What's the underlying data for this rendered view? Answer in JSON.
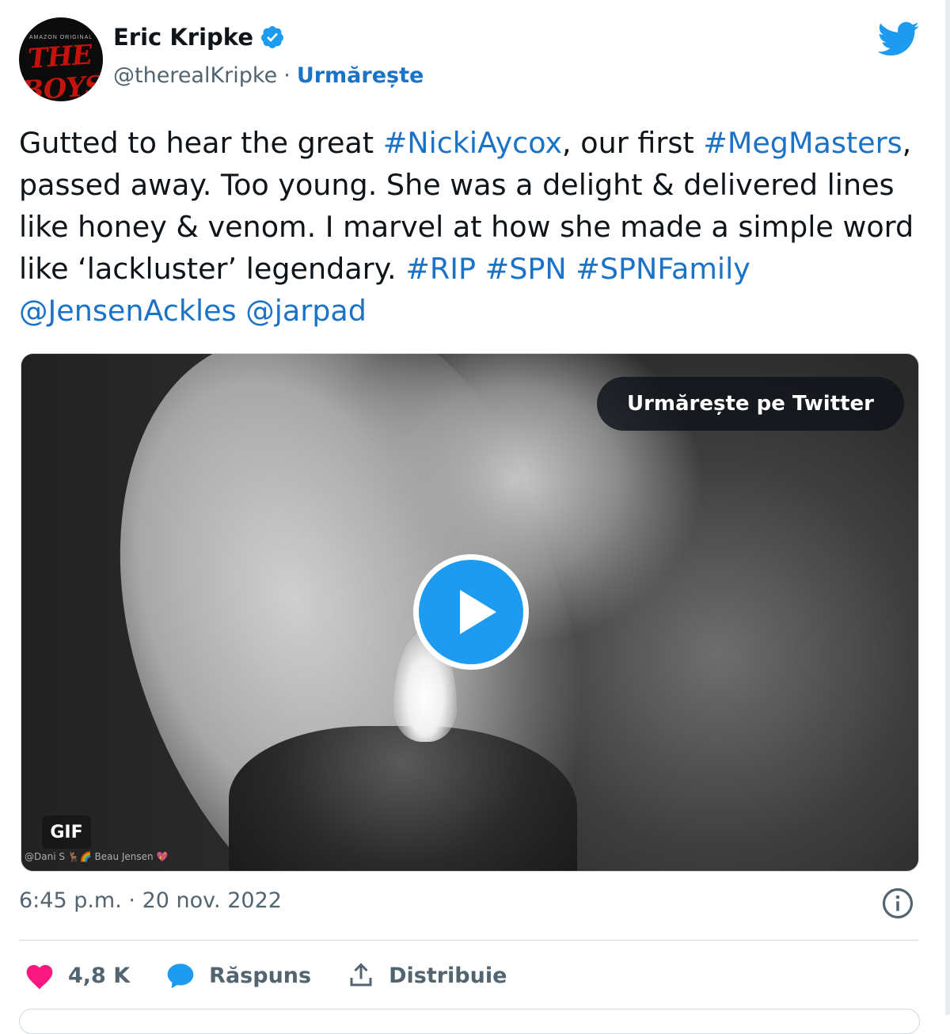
{
  "user": {
    "name": "Eric Kripke",
    "handle": "@therealKripke",
    "separator": "·",
    "follow_label": "Urmărește",
    "avatar_caption": "AMAZON ORIGINAL",
    "avatar_logo": "THE BOYS"
  },
  "tweet": {
    "segments": [
      {
        "text": "Gutted to hear the great ",
        "link": false
      },
      {
        "text": "#NickiAycox",
        "link": true
      },
      {
        "text": ", our first ",
        "link": false
      },
      {
        "text": "#MegMasters",
        "link": true
      },
      {
        "text": ", passed away. Too young. She was a delight & delivered lines like honey & venom. I marvel at how she made a simple word like ‘lackluster’ legendary. ",
        "link": false
      },
      {
        "text": "#RIP",
        "link": true
      },
      {
        "text": " ",
        "link": false
      },
      {
        "text": "#SPN",
        "link": true
      },
      {
        "text": " ",
        "link": false
      },
      {
        "text": "#SPNFamily",
        "link": true
      },
      {
        "text": " ",
        "link": false
      },
      {
        "text": "@JensenAckles",
        "link": true
      },
      {
        "text": " ",
        "link": false
      },
      {
        "text": "@jarpad",
        "link": true
      }
    ]
  },
  "media": {
    "follow_on_twitter_label": "Urmărește pe Twitter",
    "gif_badge": "GIF",
    "watermark": "@Dani S 🦌🌈 Beau Jensen 💖"
  },
  "meta": {
    "time": "6:45 p.m.",
    "separator": "·",
    "date": "20 nov. 2022"
  },
  "actions": {
    "like_count": "4,8 K",
    "reply_label": "Răspuns",
    "share_label": "Distribuie"
  },
  "colors": {
    "link": "#1b73c7",
    "twitter_blue": "#1d9bf0",
    "heart": "#f91880",
    "text": "#0f1419",
    "muted": "#536471"
  },
  "icons": [
    "verified-badge-icon",
    "twitter-bird-icon",
    "play-icon",
    "info-icon",
    "heart-icon",
    "reply-bubble-icon",
    "share-upload-icon"
  ]
}
